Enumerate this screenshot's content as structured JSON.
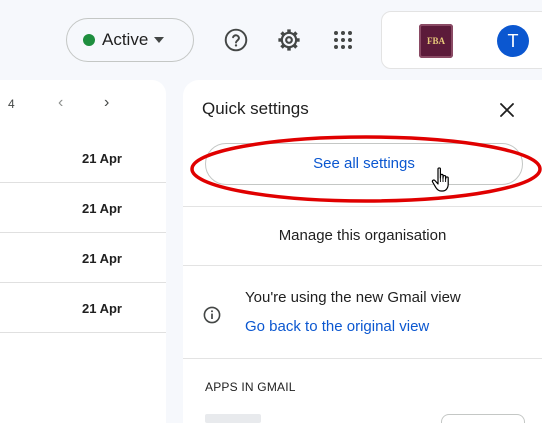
{
  "header": {
    "status": {
      "label": "Active",
      "dot_color": "#1e8e3e"
    },
    "help_icon": "help-circle-icon",
    "settings_icon": "gear-icon",
    "apps_icon": "apps-grid-icon",
    "org_logo_text": "FBA",
    "avatar_initial": "T",
    "avatar_color": "#0b57d0"
  },
  "mail_list": {
    "pager_count": "4",
    "rows": [
      {
        "date": "21 Apr"
      },
      {
        "date": "21 Apr"
      },
      {
        "date": "21 Apr"
      },
      {
        "date": "21 Apr"
      }
    ]
  },
  "quick_settings": {
    "title": "Quick settings",
    "see_all_label": "See all settings",
    "manage_org_label": "Manage this organisation",
    "gmail_view_text": "You're using the new Gmail view",
    "go_back_link": "Go back to the original view",
    "apps_heading": "APPS IN GMAIL",
    "highlight_color": "#e00000",
    "link_color": "#0b57d0"
  }
}
